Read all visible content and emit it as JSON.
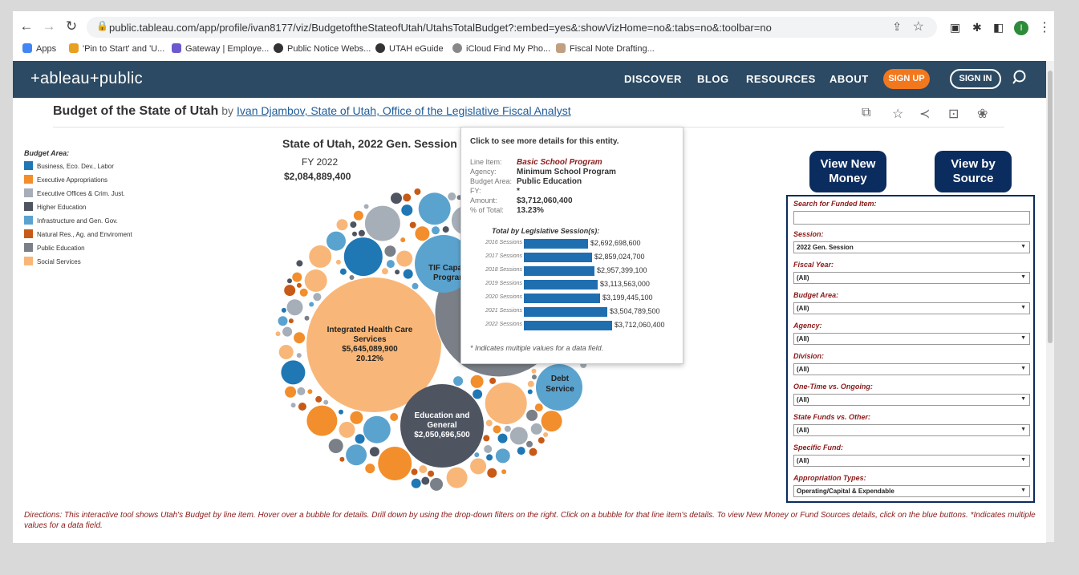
{
  "browser": {
    "url": "public.tableau.com/app/profile/ivan8177/viz/BudgetoftheStateofUtah/UtahsTotalBudget?:embed=yes&:showVizHome=no&:tabs=no&:toolbar=no",
    "profile_initial": "I",
    "bookmarks": [
      {
        "label": "Apps",
        "color": "#4285f4"
      },
      {
        "label": "'Pin to Start' and 'U...",
        "color": "#e8a020"
      },
      {
        "label": "Gateway | Employe...",
        "color": "#6a5acd"
      },
      {
        "label": "Public Notice Webs...",
        "color": "#333333"
      },
      {
        "label": "UTAH eGuide",
        "color": "#333333"
      },
      {
        "label": "iCloud Find My Pho...",
        "color": "#888888"
      },
      {
        "label": "Fiscal Note Drafting...",
        "color": "#c0a080"
      }
    ]
  },
  "tableau_header": {
    "logo": "+ableau+public",
    "nav": [
      "DISCOVER",
      "BLOG",
      "RESOURCES",
      "ABOUT"
    ],
    "signup": "SIGN UP",
    "signin": "SIGN IN"
  },
  "page": {
    "title": "Budget of the State of Utah",
    "by": "by",
    "author": "Ivan Djambov, State of Utah, Office of the Legislative Fiscal Analyst"
  },
  "legend": {
    "title": "Budget Area:",
    "items": [
      {
        "label": "Business, Eco. Dev., Labor",
        "color": "#1f77b4"
      },
      {
        "label": "Executive Appropriations",
        "color": "#f28e2b"
      },
      {
        "label": "Executive Offices & Crim. Just.",
        "color": "#a6aeb8"
      },
      {
        "label": "Higher Education",
        "color": "#4e5561"
      },
      {
        "label": "Infrastructure and Gen. Gov.",
        "color": "#5ba3cf"
      },
      {
        "label": "Natural Res., Ag. and Enviroment",
        "color": "#c85a17"
      },
      {
        "label": "Public Education",
        "color": "#7b8088"
      },
      {
        "label": "Social Services",
        "color": "#f8b778"
      }
    ]
  },
  "viz": {
    "title": "State of Utah, 2022 Gen. Session",
    "fy": "FY 2022",
    "total": "$2,084,889,400",
    "bubble_labels": {
      "ihcs_name": "Integrated Health Care Services",
      "ihcs_amount": "$5,645,089,900",
      "ihcs_pct": "20.12%",
      "edu_name": "Education and General",
      "edu_amount": "$2,050,696,500",
      "debt_name": "Debt Service",
      "tif_name": "TIF Capaci... Program"
    }
  },
  "tooltip": {
    "header": "Click to see more details for this entity.",
    "fields": [
      {
        "key": "Line Item:",
        "value": "Basic School Program"
      },
      {
        "key": "Agency:",
        "value": "Minimum School Program"
      },
      {
        "key": "Budget Area:",
        "value": "Public Education"
      },
      {
        "key": "FY:",
        "value": "*"
      },
      {
        "key": "Amount:",
        "value": "$3,712,060,400"
      },
      {
        "key": "% of Total:",
        "value": "13.23%"
      }
    ],
    "subtitle": "Total by Legislative Session(s):",
    "note": "* Indicates multiple values for a data field."
  },
  "chart_data": {
    "type": "bar",
    "title": "Total by Legislative Session(s):",
    "categories": [
      "2016 Sessions",
      "2017 Sessions",
      "2018 Sessions",
      "2019 Sessions",
      "2020 Sessions",
      "2021 Sessions",
      "2022 Sessions"
    ],
    "values": [
      2692698600,
      2859024700,
      2957399100,
      3113563000,
      3199445100,
      3504789500,
      3712060400
    ],
    "value_labels": [
      "$2,692,698,600",
      "$2,859,024,700",
      "$2,957,399,100",
      "$3,113,563,000",
      "$3,199,445,100",
      "$3,504,789,500",
      "$3,712,060,400"
    ],
    "orientation": "horizontal",
    "color": "#1f6fb0"
  },
  "buttons": {
    "new_money": "View New Money",
    "by_source": "View by Source"
  },
  "filters": {
    "search_label": "Search for Funded Item:",
    "items": [
      {
        "label": "Session:",
        "value": "2022 Gen. Session"
      },
      {
        "label": "Fiscal Year:",
        "value": "(All)"
      },
      {
        "label": "Budget Area:",
        "value": "(All)"
      },
      {
        "label": "Agency:",
        "value": "(All)"
      },
      {
        "label": "Division:",
        "value": "(All)"
      },
      {
        "label": "One-Time vs. Ongoing:",
        "value": "(All)"
      },
      {
        "label": "State Funds vs. Other:",
        "value": "(All)"
      },
      {
        "label": "Specific Fund:",
        "value": "(All)"
      },
      {
        "label": "Appropriation Types:",
        "value": "Operating/Capital & Expendable"
      }
    ]
  },
  "directions": "Directions: This interactive tool shows Utah's Budget by line item. Hover over a bubble for details. Drill down by using the drop-down filters on the right. Click on a bubble for that line item's details. To view New Money or Fund Sources details, click on the blue buttons. *Indicates multiple values for a data field."
}
